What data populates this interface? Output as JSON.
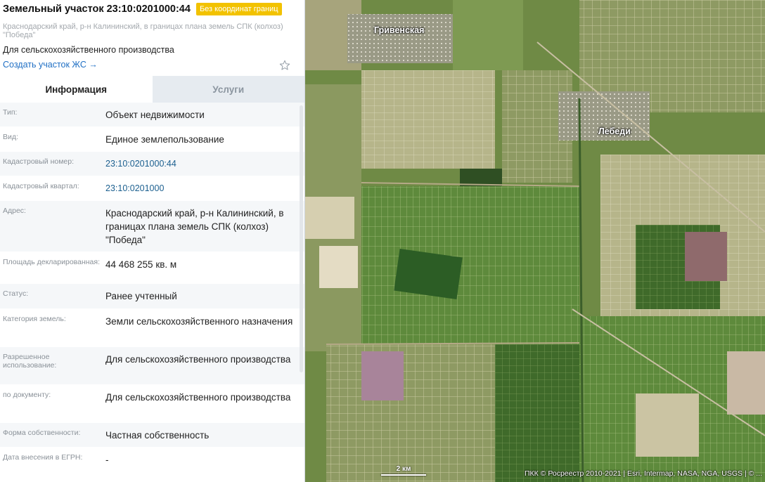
{
  "header": {
    "title": "Земельный участок 23:10:0201000:44",
    "badge": "Без координат границ",
    "address_sub": "Краснодарский край, р-н Калининский, в границах плана земель СПК (колхоз) \"Победа\"",
    "purpose": "Для сельскохозяйственного производства",
    "create_link": "Создать участок ЖС →"
  },
  "tabs": [
    {
      "label": "Информация",
      "active": true
    },
    {
      "label": "Услуги",
      "active": false
    }
  ],
  "info_rows": [
    {
      "label": "Тип:",
      "value": "Объект недвижимости"
    },
    {
      "label": "Вид:",
      "value": "Единое землепользование"
    },
    {
      "label": "Кадастровый номер:",
      "value": "23:10:0201000:44"
    },
    {
      "label": "Кадастровый квартал:",
      "value": "23:10:0201000"
    },
    {
      "label": "Адрес:",
      "value": "Краснодарский край, р-н Калининский, в границах плана земель СПК (колхоз) \"Победа\""
    },
    {
      "label": "Площадь декларированная:",
      "value": "44 468 255 кв. м"
    },
    {
      "label": "Статус:",
      "value": "Ранее учтенный"
    },
    {
      "label": "Категория земель:",
      "value": "Земли сельскохозяйственного назначения"
    },
    {
      "label": "Разрешенное использование:",
      "value": "Для сельскохозяйственного производства"
    },
    {
      "label": "по документу:",
      "value": "Для сельскохозяйственного производства"
    },
    {
      "label": "Форма собственности:",
      "value": "Частная собственность"
    },
    {
      "label": "Дата внесения в ЕГРН:",
      "value": "-"
    }
  ],
  "map": {
    "labels": [
      "Гривенская",
      "Лебеди"
    ],
    "scale": "2 км",
    "attribution": "ПКК © Росреестр 2010-2021 | Esri, Intermap, NASA, NGA, USGS | © ..."
  },
  "colors": {
    "badge": "#f2c200",
    "link": "#1f6fc4",
    "tab_inactive_bg": "#e6ebf0"
  }
}
